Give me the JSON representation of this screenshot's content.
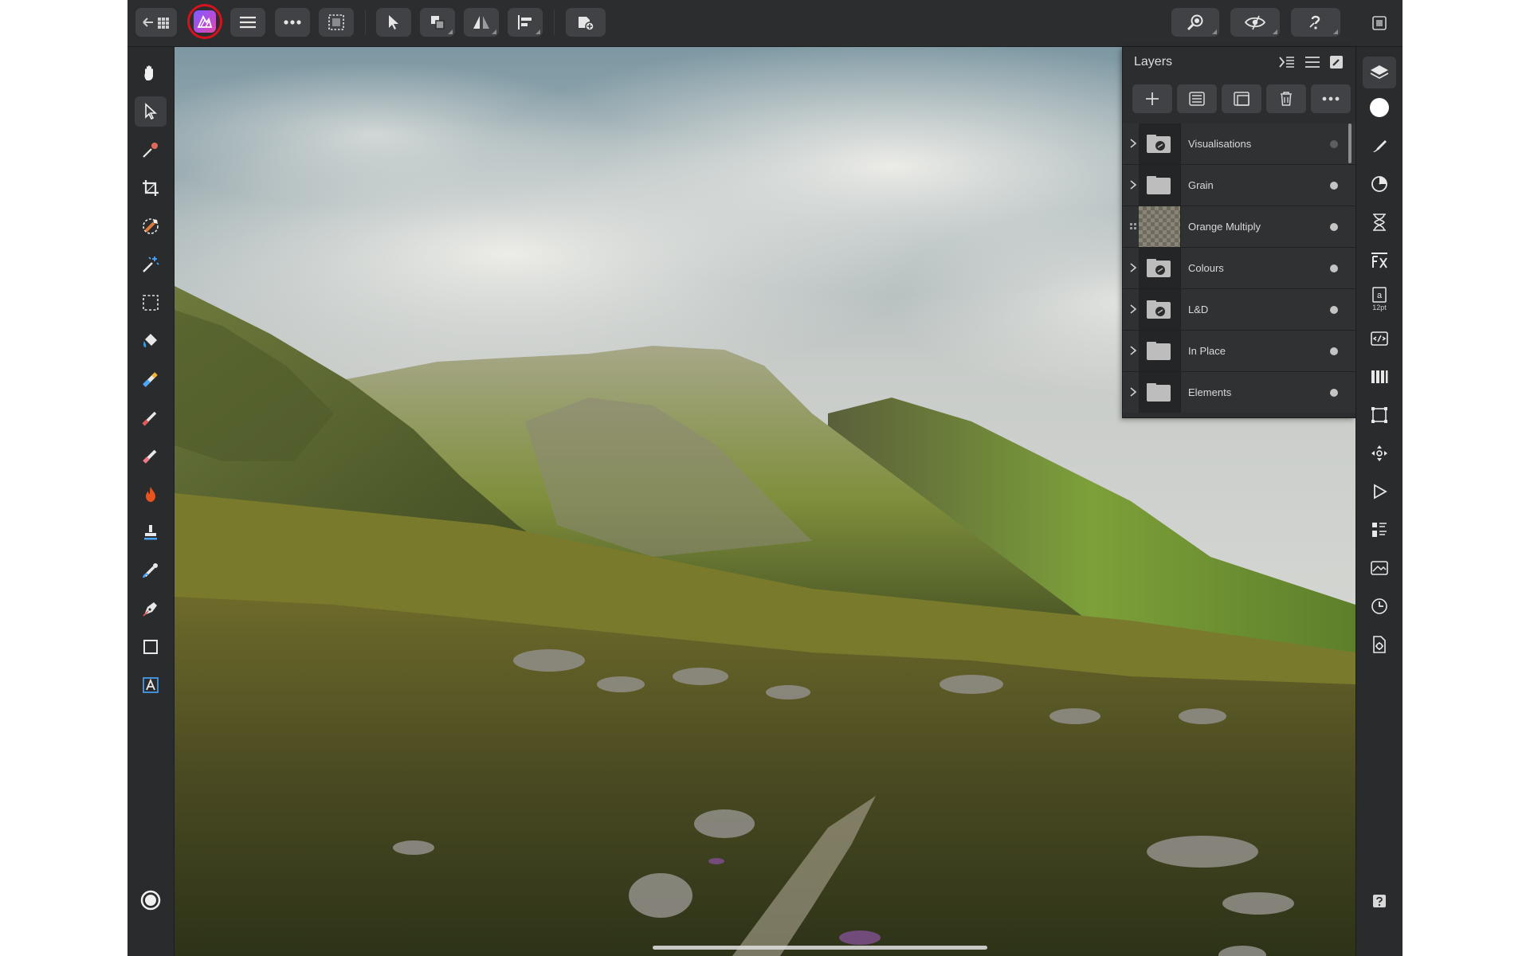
{
  "toolbar": {
    "icons": [
      "back-grid-icon",
      "persona-photo-icon",
      "menu-icon",
      "more-icon",
      "selection-icon",
      "move-tool-icon",
      "arrange-icon",
      "flip-icon",
      "align-icon",
      "add-image-icon",
      "zoom-icon",
      "view-quality-icon",
      "help-icon",
      "fullscreen-icon"
    ],
    "persona_ring_color": "#d6121c"
  },
  "tools": [
    "hand",
    "move",
    "color-picker",
    "crop",
    "selection-brush",
    "flood-select",
    "marquee",
    "flood-fill",
    "paint-mixer",
    "paint-brush",
    "erase-brush",
    "dodge-burn",
    "clone",
    "retouch",
    "pen",
    "rectangle",
    "text",
    "color-wheel"
  ],
  "layers_panel": {
    "title": "Layers",
    "actions": [
      "add-layer",
      "add-adjustment",
      "add-group",
      "delete",
      "more"
    ],
    "items": [
      {
        "name": "Visualisations",
        "type": "group-live",
        "visible": false
      },
      {
        "name": "Grain",
        "type": "group",
        "visible": true
      },
      {
        "name": "Orange Multiply",
        "type": "pixel",
        "visible": true
      },
      {
        "name": "Colours",
        "type": "group-live",
        "visible": true
      },
      {
        "name": "L&D",
        "type": "group-live",
        "visible": true
      },
      {
        "name": "In Place",
        "type": "group",
        "visible": true
      },
      {
        "name": "Elements",
        "type": "group",
        "visible": true
      }
    ]
  },
  "studio": {
    "text_size_label": "12pt"
  }
}
